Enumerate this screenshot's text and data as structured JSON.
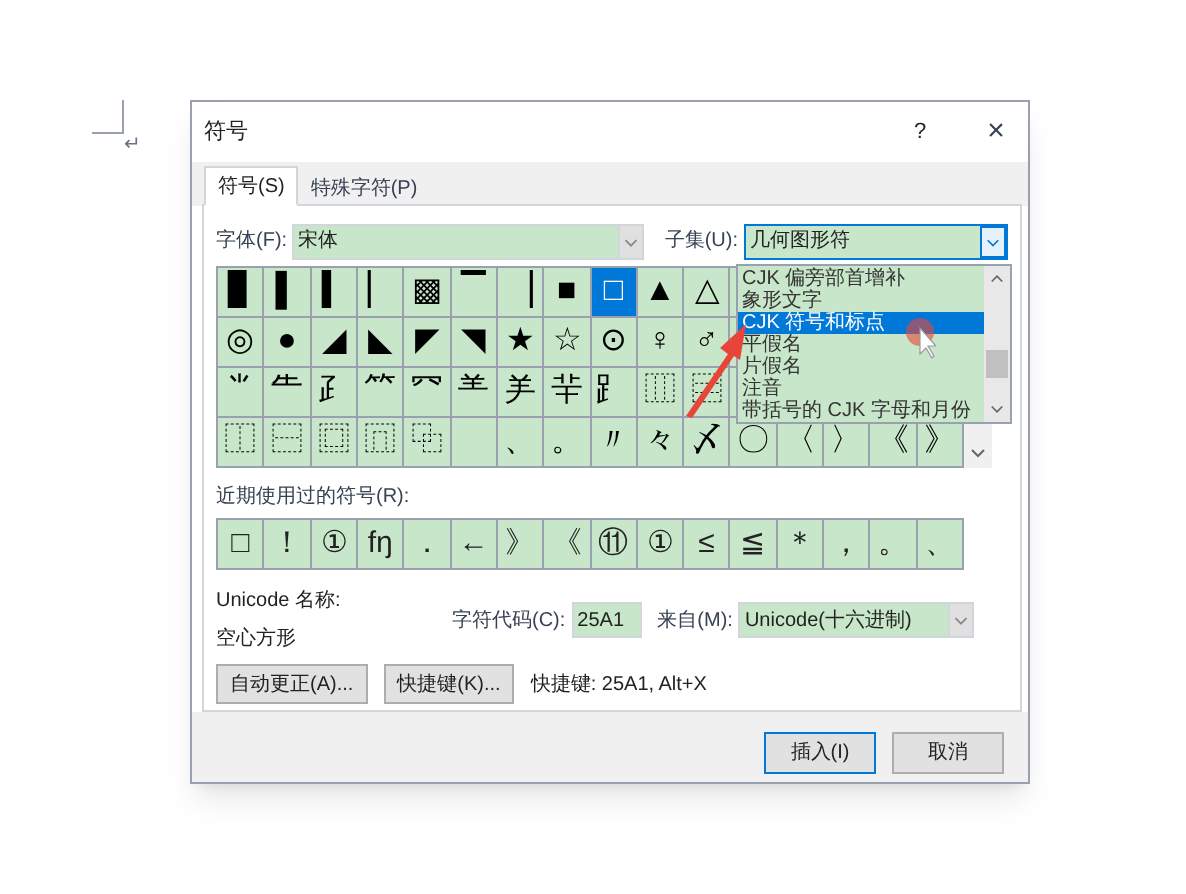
{
  "document": {
    "paragraph_mark": "↵"
  },
  "window": {
    "title": "符号",
    "help": "?",
    "close": "×"
  },
  "tabs": [
    {
      "label": "符号(S)",
      "selected": true
    },
    {
      "label": "特殊字符(P)",
      "selected": false
    }
  ],
  "font": {
    "label": "字体(F):",
    "value": "宋体"
  },
  "subset": {
    "label": "子集(U):",
    "value": "几何图形符",
    "expanded": true,
    "options": [
      {
        "label": "CJK 偏旁部首增补",
        "selected": false
      },
      {
        "label": "象形文字",
        "selected": false
      },
      {
        "label": "CJK 符号和标点",
        "selected": true
      },
      {
        "label": "平假名",
        "selected": false
      },
      {
        "label": "片假名",
        "selected": false
      },
      {
        "label": "注音",
        "selected": false
      },
      {
        "label": "带括号的 CJK 字母和月份",
        "selected": false
      }
    ]
  },
  "symbols": {
    "rows": [
      [
        {
          "char": "▊",
          "selected": false
        },
        {
          "char": "▌",
          "selected": false
        },
        {
          "char": "▍",
          "selected": false
        },
        {
          "char": "▏",
          "selected": false
        },
        {
          "char": "▩",
          "selected": false
        },
        {
          "char": "▔",
          "selected": false
        },
        {
          "char": "▕",
          "selected": false
        },
        {
          "char": "■",
          "selected": false
        },
        {
          "char": "□",
          "selected": true
        },
        {
          "char": "▲",
          "selected": false
        },
        {
          "char": "△",
          "selected": false
        }
      ],
      [
        {
          "char": "◎",
          "selected": false
        },
        {
          "char": "●",
          "selected": false
        },
        {
          "char": "◢",
          "selected": false
        },
        {
          "char": "◣",
          "selected": false
        },
        {
          "char": "◤",
          "selected": false
        },
        {
          "char": "◥",
          "selected": false
        },
        {
          "char": "★",
          "selected": false
        },
        {
          "char": "☆",
          "selected": false
        },
        {
          "char": "⊙",
          "selected": false
        },
        {
          "char": "♀",
          "selected": false
        },
        {
          "char": "♂",
          "selected": false
        }
      ],
      [
        {
          "char": "⺌",
          "selected": false
        },
        {
          "char": "⺧",
          "selected": false
        },
        {
          "char": "⺪",
          "selected": false
        },
        {
          "char": "⺮",
          "selected": false
        },
        {
          "char": "⺳",
          "selected": false
        },
        {
          "char": "⺷",
          "selected": false
        },
        {
          "char": "⺶",
          "selected": false
        },
        {
          "char": "⺸",
          "selected": false
        },
        {
          "char": "⻊",
          "selected": false
        },
        {
          "char": "⿲",
          "selected": false
        },
        {
          "char": "⿳",
          "selected": false
        }
      ],
      [
        {
          "char": "⿰",
          "selected": false
        },
        {
          "char": "⿱",
          "selected": false
        },
        {
          "char": "⿴",
          "selected": false
        },
        {
          "char": "⿵",
          "selected": false
        },
        {
          "char": "⿻",
          "selected": false
        },
        null,
        {
          "char": "、",
          "selected": false
        },
        {
          "char": "。",
          "selected": false
        },
        {
          "char": "〃",
          "selected": false
        },
        {
          "char": "々",
          "selected": false
        },
        {
          "char": "〆",
          "selected": false
        },
        {
          "char": "〇",
          "selected": false
        },
        {
          "char": "〈",
          "selected": false
        },
        {
          "char": "〉",
          "selected": false
        },
        {
          "char": "《",
          "selected": false
        },
        {
          "char": "》",
          "selected": false
        }
      ]
    ]
  },
  "recent": {
    "label": "近期使用过的符号(R):",
    "symbols": [
      "□",
      "！",
      "①",
      "fŋ",
      "．",
      "←",
      "》",
      "《",
      "⑪",
      "①",
      "≤",
      "≦",
      "＊",
      "，",
      "。",
      "、"
    ]
  },
  "unicode_name": {
    "label": "Unicode 名称:",
    "value": "空心方形"
  },
  "char_code": {
    "label": "字符代码(C):",
    "value": "25A1"
  },
  "from": {
    "label": "来自(M):",
    "value": "Unicode(十六进制)"
  },
  "buttons": [
    {
      "label": "自动更正(A)..."
    },
    {
      "label": "快捷键(K)..."
    }
  ],
  "shortcut": "快捷键: 25A1, Alt+X",
  "footer_buttons": [
    {
      "label": "插入(I)",
      "default": true
    },
    {
      "label": "取消",
      "default": false
    }
  ]
}
